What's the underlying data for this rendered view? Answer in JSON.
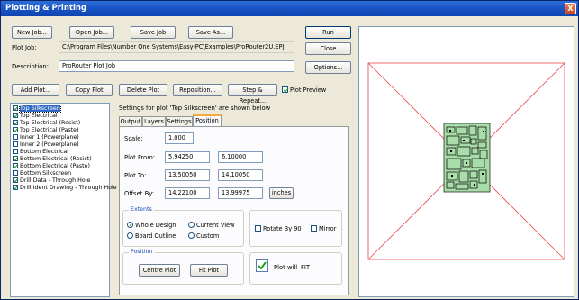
{
  "window": {
    "title": "Plotting & Printing",
    "close_glyph": "X"
  },
  "toolbar": {
    "new_job": "New Job...",
    "open_job": "Open Job...",
    "save_job": "Save Job",
    "save_as": "Save As...",
    "run": "Run",
    "close": "Close",
    "options": "Options..."
  },
  "plot_job": {
    "label": "Plot Job:",
    "value": "C:\\Program Files\\Number One Systems\\Easy-PC\\Examples\\ProRouter2U.EPJ"
  },
  "description": {
    "label": "Description:",
    "value": "ProRouter Plot Job"
  },
  "plot_actions": {
    "add": "Add Plot...",
    "copy": "Copy Plot",
    "delete": "Delete Plot",
    "reposition": "Reposition...",
    "step_repeat": "Step & Repeat...",
    "plot_preview": "Plot Preview"
  },
  "layers": [
    {
      "name": "Top Silkscreen",
      "checked": true,
      "selected": true
    },
    {
      "name": "Top Electrical",
      "checked": true
    },
    {
      "name": "Top Electrical (Resist)",
      "checked": true
    },
    {
      "name": "Top Electrical (Paste)",
      "checked": true
    },
    {
      "name": "Inner 1 (Powerplane)",
      "checked": false
    },
    {
      "name": "Inner 2 (Powerplane)",
      "checked": false
    },
    {
      "name": "Bottom Electrical",
      "checked": false
    },
    {
      "name": "Bottom Electrical (Resist)",
      "checked": true
    },
    {
      "name": "Bottom Electrical (Paste)",
      "checked": true
    },
    {
      "name": "Bottom Silkscreen",
      "checked": false
    },
    {
      "name": "Drill Data - Through Hole",
      "checked": true
    },
    {
      "name": "Drill Ident Drawing - Through Hole",
      "checked": true
    }
  ],
  "settings": {
    "heading": "Settings for plot 'Top Silkscreen' are shown below",
    "tabs": [
      "Output",
      "Layers",
      "Settings",
      "Position"
    ],
    "scale_label": "Scale:",
    "scale": "1.000",
    "plot_from_label": "Plot From:",
    "plot_from_x": "5.94250",
    "plot_from_y": "6.10000",
    "plot_to_label": "Plot To:",
    "plot_to_x": "13.50050",
    "plot_to_y": "14.10050",
    "offset_label": "Offset By:",
    "offset_x": "14.22100",
    "offset_y": "13.99975",
    "units_button": "inches",
    "extents_title": "Extents",
    "whole_design": "Whole Design",
    "current_view": "Current View",
    "board_outline": "Board Outline",
    "custom": "Custom",
    "rotate": "Rotate By 90",
    "mirror": "Mirror",
    "position_title": "Position",
    "centre_plot": "Centre Plot",
    "fit_plot": "Fit Plot",
    "plot_will": "Plot will",
    "fit_status": "FIT"
  },
  "colors": {
    "board": "#a8dca8",
    "lines": "#e8474a",
    "accent": "#21a121"
  }
}
